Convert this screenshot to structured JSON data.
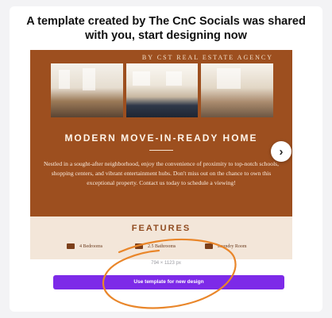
{
  "headline": "A template created by The CnC Socials was shared with you, start designing now",
  "preview": {
    "agency": "BY CST REAL ESTATE AGENCY",
    "title": "MODERN MOVE-IN-READY HOME",
    "body": "Nestled in a sought-after neighborhood, enjoy the convenience of proximity to top-notch schools, shopping centers, and vibrant entertainment hubs. Don't miss out on the chance to own this exceptional property. Contact us today to schedule a viewing!",
    "features_title": "FEATURES",
    "features": [
      {
        "label": "4 Bedrooms",
        "icon": "bed-icon"
      },
      {
        "label": "2.5 Bathrooms",
        "icon": "bathtub-icon"
      },
      {
        "label": "Laundry Room",
        "icon": "washer-icon"
      }
    ]
  },
  "dimensions": "794 × 1123 px",
  "use_button": "Use template for new design",
  "next_icon": "chevron-right-icon",
  "colors": {
    "accent": "#7d2ae8",
    "preview_bg": "#9d4f1f",
    "annotation": "#e9862a"
  }
}
